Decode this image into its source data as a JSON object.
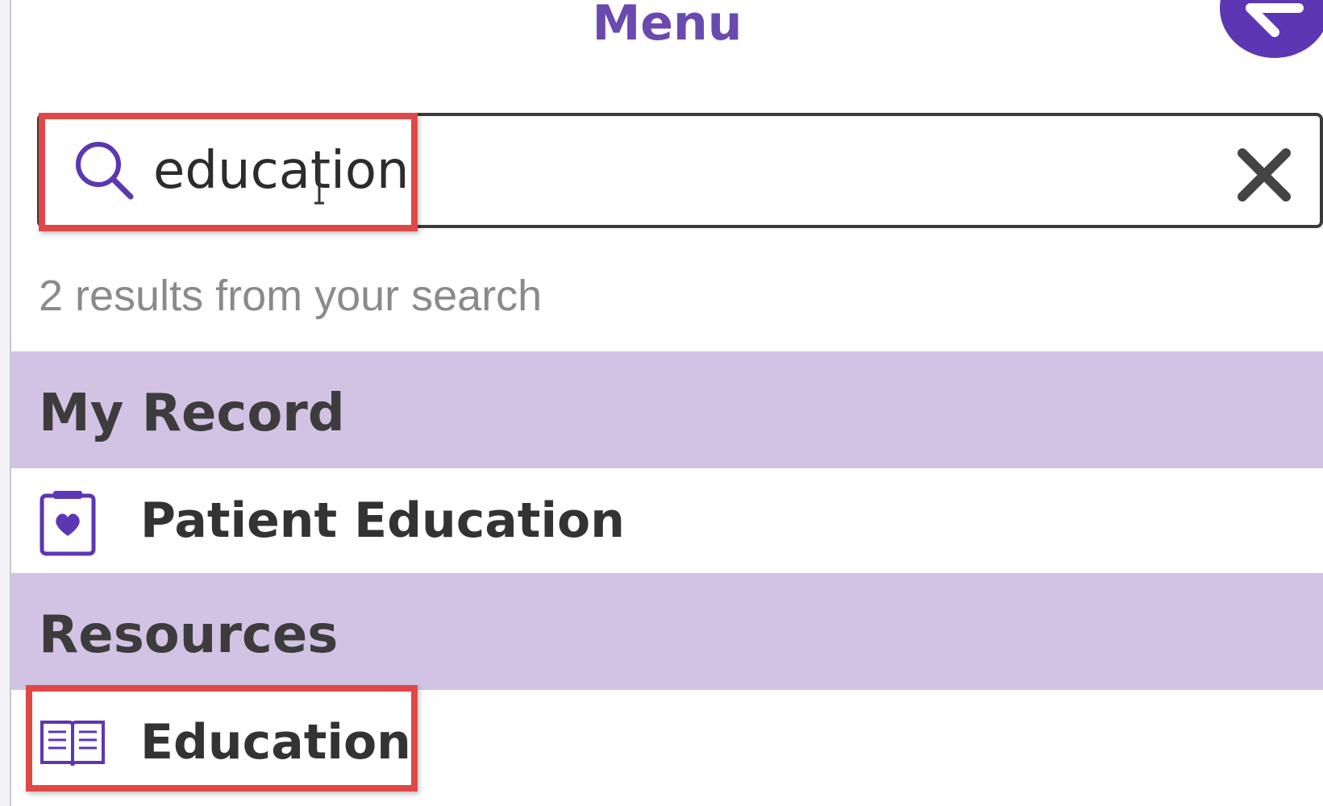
{
  "header": {
    "title": "Menu"
  },
  "search": {
    "value": "education",
    "placeholder": ""
  },
  "results": {
    "summary": "2 results from your search",
    "sections": [
      {
        "heading": "My Record",
        "items": [
          {
            "label": "Patient Education",
            "icon": "patient-education-icon"
          }
        ]
      },
      {
        "heading": "Resources",
        "items": [
          {
            "label": "Education",
            "icon": "open-book-icon"
          }
        ]
      }
    ]
  },
  "colors": {
    "brand_purple": "#5d36b3",
    "title_purple": "#6a49b0",
    "section_band": "#d2c3e4",
    "annotation_red": "#e04848"
  }
}
